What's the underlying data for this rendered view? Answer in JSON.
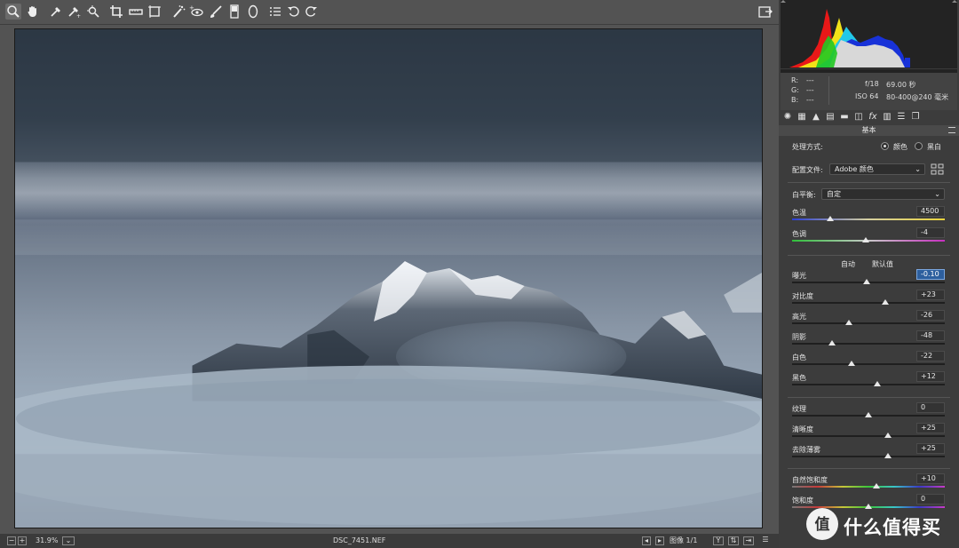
{
  "status": {
    "zoom": "31.9%",
    "filename": "DSC_7451.NEF",
    "image_counter": "图像 1/1"
  },
  "info": {
    "r_label": "R:",
    "r_val": "---",
    "g_label": "G:",
    "g_val": "---",
    "b_label": "B:",
    "b_val": "---",
    "aperture": "f/18",
    "shutter": "69.00 秒",
    "iso": "ISO 64",
    "lens": "80-400@240 毫米"
  },
  "panel": {
    "section_title": "基本",
    "treatment_label": "处理方式:",
    "treatment_color": "颜色",
    "treatment_bw": "黑白",
    "profile_label": "配置文件:",
    "profile_value": "Adobe 颜色",
    "wb_label": "白平衡:",
    "wb_value": "自定",
    "auto_label": "自动",
    "default_label": "默认值"
  },
  "sliders": [
    {
      "label": "色温",
      "value": "4500",
      "level": 0.25
    },
    {
      "label": "色调",
      "value": "-4",
      "level": 0.48
    },
    {
      "label": "曝光",
      "value": "-0.10",
      "level": 0.49
    },
    {
      "label": "对比度",
      "value": "+23",
      "level": 0.61
    },
    {
      "label": "高光",
      "value": "-26",
      "level": 0.37
    },
    {
      "label": "阴影",
      "value": "-48",
      "level": 0.26
    },
    {
      "label": "白色",
      "value": "-22",
      "level": 0.39
    },
    {
      "label": "黑色",
      "value": "+12",
      "level": 0.56
    },
    {
      "label": "纹理",
      "value": "0",
      "level": 0.5
    },
    {
      "label": "清晰度",
      "value": "+25",
      "level": 0.625
    },
    {
      "label": "去除薄雾",
      "value": "+25",
      "level": 0.625
    },
    {
      "label": "自然饱和度",
      "value": "+10",
      "level": 0.55
    },
    {
      "label": "饱和度",
      "value": "0",
      "level": 0.5
    }
  ],
  "watermark": {
    "text": "什么值得买",
    "logo_char": "值"
  },
  "colors": {
    "panel_bg": "#3c3c3c",
    "toolbar_bg": "#535353",
    "focus_blue": "#2d5f9e"
  }
}
